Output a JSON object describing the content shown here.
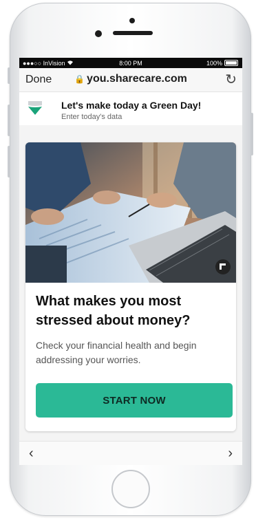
{
  "statusbar": {
    "carrier": "●●●○○ InVision",
    "time": "8:00 PM",
    "battery": "100%"
  },
  "navbar": {
    "done_label": "Done",
    "url": "you.sharecare.com"
  },
  "banner": {
    "title": "Let's make today a Green Day!",
    "subtitle": "Enter today's data"
  },
  "card": {
    "title": "What makes you most stressed about money?",
    "description": "Check your financial health and begin addressing your worries.",
    "cta_label": "START NOW"
  },
  "icons": [
    "lock-icon",
    "reload-icon",
    "heart-shield-icon",
    "expand-icon",
    "chevron-left-icon",
    "chevron-right-icon"
  ],
  "colors": {
    "accent": "#2bb996",
    "icon_green": "#1aa37a"
  }
}
